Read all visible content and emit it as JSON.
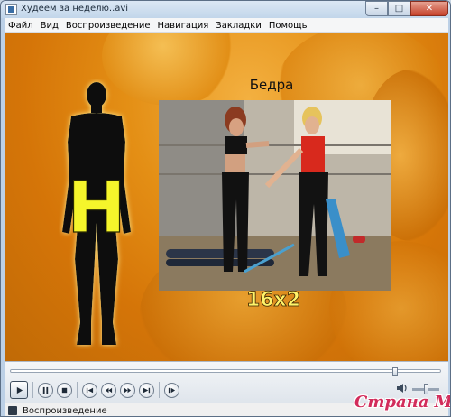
{
  "window": {
    "title": "Худеем за неделю..avi"
  },
  "titlebar_buttons": {
    "minimize": "–",
    "maximize": "□",
    "close": "✕"
  },
  "menu": [
    "Файл",
    "Вид",
    "Воспроизведение",
    "Навигация",
    "Закладки",
    "Помощь"
  ],
  "video": {
    "section_title": "Бедра",
    "letter": "Н",
    "reps": "16х2"
  },
  "playback": {
    "seek_progress": 0.9,
    "volume_level": 0.5
  },
  "controls": [
    "play",
    "pause",
    "stop",
    "previous",
    "rewind",
    "fast-forward",
    "next",
    "frame-step"
  ],
  "status": {
    "text": "Воспроизведение"
  },
  "watermark": "Страна Мам",
  "colors": {
    "video_bg": "#e48f15",
    "letter_fill": "#f5f52b",
    "reps_text": "#fff36a",
    "watermark": "#d22c5b"
  }
}
